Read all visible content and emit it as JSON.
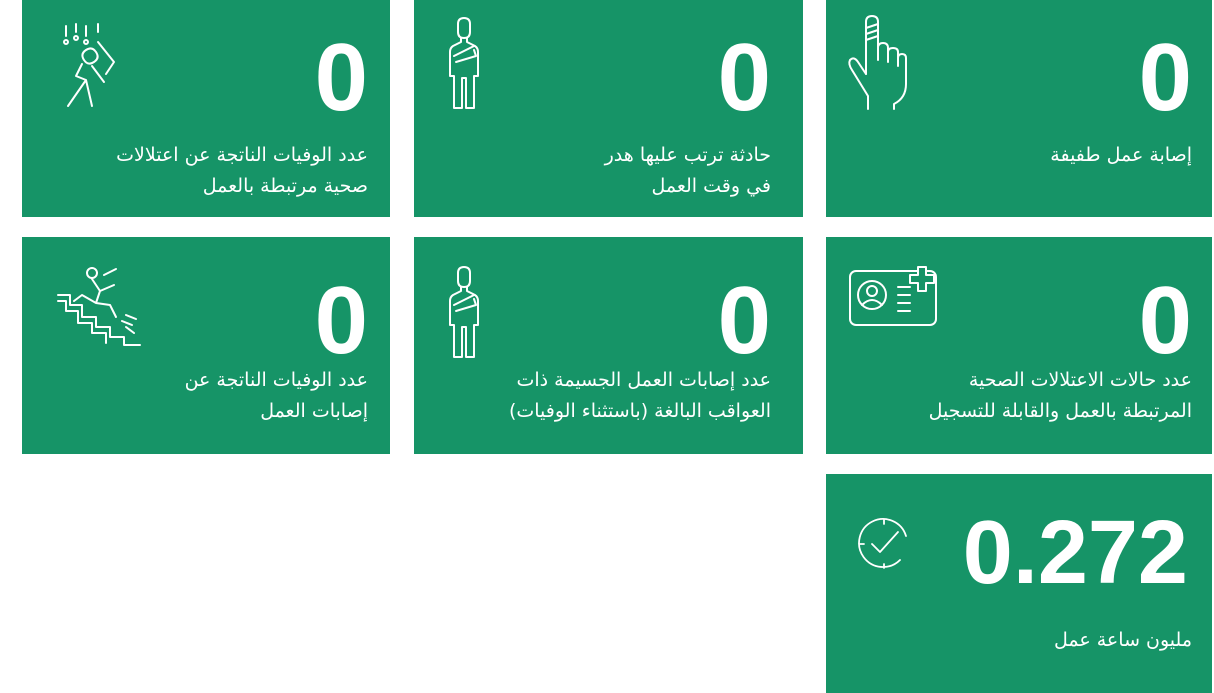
{
  "colors": {
    "card_bg": "#169467",
    "text": "#ffffff",
    "page_bg": "#ffffff"
  },
  "cards": [
    {
      "id": "minor-injury",
      "value": "0",
      "label_lines": [
        "إصابة عمل طفيفة"
      ],
      "icon": "bandaged-finger-icon"
    },
    {
      "id": "lost-time-accident",
      "value": "0",
      "label_lines": [
        "حادثة ترتب عليها هدر",
        "في وقت العمل"
      ],
      "icon": "arm-sling-person-icon"
    },
    {
      "id": "ill-health-deaths",
      "value": "0",
      "label_lines": [
        "عدد الوفيات الناتجة عن اعتلالات",
        "صحية مرتبطة بالعمل"
      ],
      "icon": "falling-objects-person-icon"
    },
    {
      "id": "ill-health-cases",
      "value": "0",
      "label_lines": [
        "عدد حالات الاعتلالات الصحية",
        "المرتبطة بالعمل والقابلة للتسجيل"
      ],
      "icon": "medical-id-card-icon"
    },
    {
      "id": "serious-injuries",
      "value": "0",
      "label_lines": [
        "عدد إصابات العمل الجسيمة ذات",
        "العواقب البالغة (باستثناء الوفيات)"
      ],
      "icon": "arm-sling-person-icon"
    },
    {
      "id": "injury-deaths",
      "value": "0",
      "label_lines": [
        "عدد الوفيات الناتجة عن",
        "إصابات العمل"
      ],
      "icon": "stairs-fall-icon"
    },
    {
      "id": "work-hours",
      "value": "0.272",
      "label_lines": [
        "مليون ساعة عمل"
      ],
      "icon": "clock-check-icon"
    }
  ]
}
